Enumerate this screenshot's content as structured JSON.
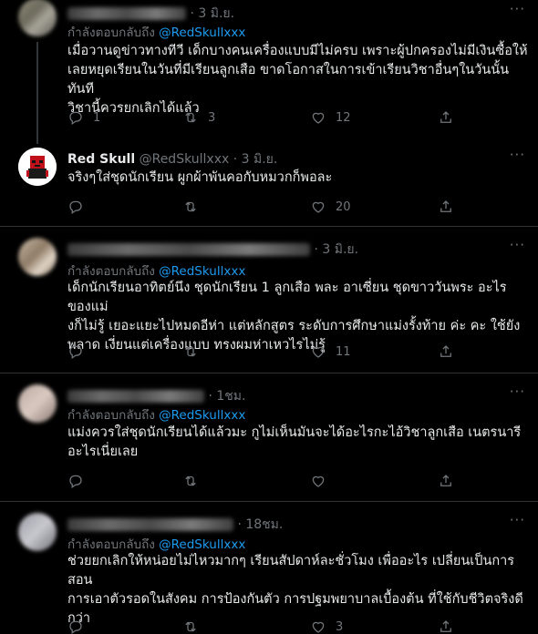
{
  "tweets": [
    {
      "time": "· 3 มิ.ย.",
      "reply_prefix": "กำลังตอบกลับถึง",
      "reply_to": "@RedSkullxxx",
      "lines": [
        "เมื่อวานดูข่าวทางทีวี เด็กบางคนเครื่องแบบมีไม่ครบ เพราะผู้ปกครองไม่มีเงินซื้อให้",
        "เลยหยุดเรียนในวันที่มีเรียนลูกเสือ ขาดโอกาสในการเข้าเรียนวิชาอื่นๆในวันนั้นทันที",
        "วิชานี้ควรยกเลิกได้แล้ว"
      ],
      "replies": "1",
      "retweets": "3",
      "likes": "12"
    },
    {
      "name": "Red Skull",
      "handle": "@RedSkullxxx",
      "time": "· 3 มิ.ย.",
      "lines": [
        "จริงๆใส่ชุดนักเรียน ผูกผ้าพันคอกับหมวกก็พอละ"
      ],
      "replies": "",
      "retweets": "",
      "likes": "20"
    },
    {
      "time": "· 3 มิ.ย.",
      "reply_prefix": "กำลังตอบกลับถึง",
      "reply_to": "@RedSkullxxx",
      "lines": [
        "เด็กนักเรียนอาทิตย์นึง ชุดนักเรียน 1 ลูกเสือ พละ อาเซี่ยน ชุดขาววันพระ อะไรของแม่",
        "งก็ไม่รู้ เยอะแยะไปหมดอีห่า แต่หลักสูตร ระดับการศึกษาแม่งรั้งท้าย ค่ะ คะ ใช้ยัง",
        "พลาด เงี่ยนแต่เครื่องแบบ ทรงผมห่าเหวไรไม่รู้"
      ],
      "replies": "",
      "retweets": "",
      "likes": "11"
    },
    {
      "time": "· 1ชม.",
      "reply_prefix": "กำลังตอบกลับถึง",
      "reply_to": "@RedSkullxxx",
      "lines": [
        "แม่งควรใส่ชุดนักเรียนได้แล้วมะ กูไม่เห็นมันจะได้อะไรกะไอ้วิชาลูกเสือ เนตรนารี",
        "อะไรเนี่ยเลย"
      ],
      "replies": "",
      "retweets": "",
      "likes": ""
    },
    {
      "time": "· 18ชม.",
      "reply_prefix": "กำลังตอบกลับถึง",
      "reply_to": "@RedSkullxxx",
      "lines": [
        "ช่วยยกเลิกให้หน่อยไม่ไหวมากๆ เรียนสัปดาห์ละชั่วโมง เพื่ออะไร เปลี่ยนเป็นการสอน",
        "การเอาตัวรอดในสังคม การป้องกันตัว การปฐมพยาบาลเบื้องต้น ที่ใช้กับชีวิตจริงดี",
        "กว่า"
      ],
      "replies": "",
      "retweets": "",
      "likes": "3"
    }
  ],
  "icons": [
    "more-icon",
    "reply-icon",
    "retweet-icon",
    "like-icon",
    "share-icon"
  ],
  "colors": {
    "background": "#000000",
    "text": "#e7e9ea",
    "muted": "#71767b",
    "link": "#1d9bf0",
    "divider": "#2f3336"
  }
}
